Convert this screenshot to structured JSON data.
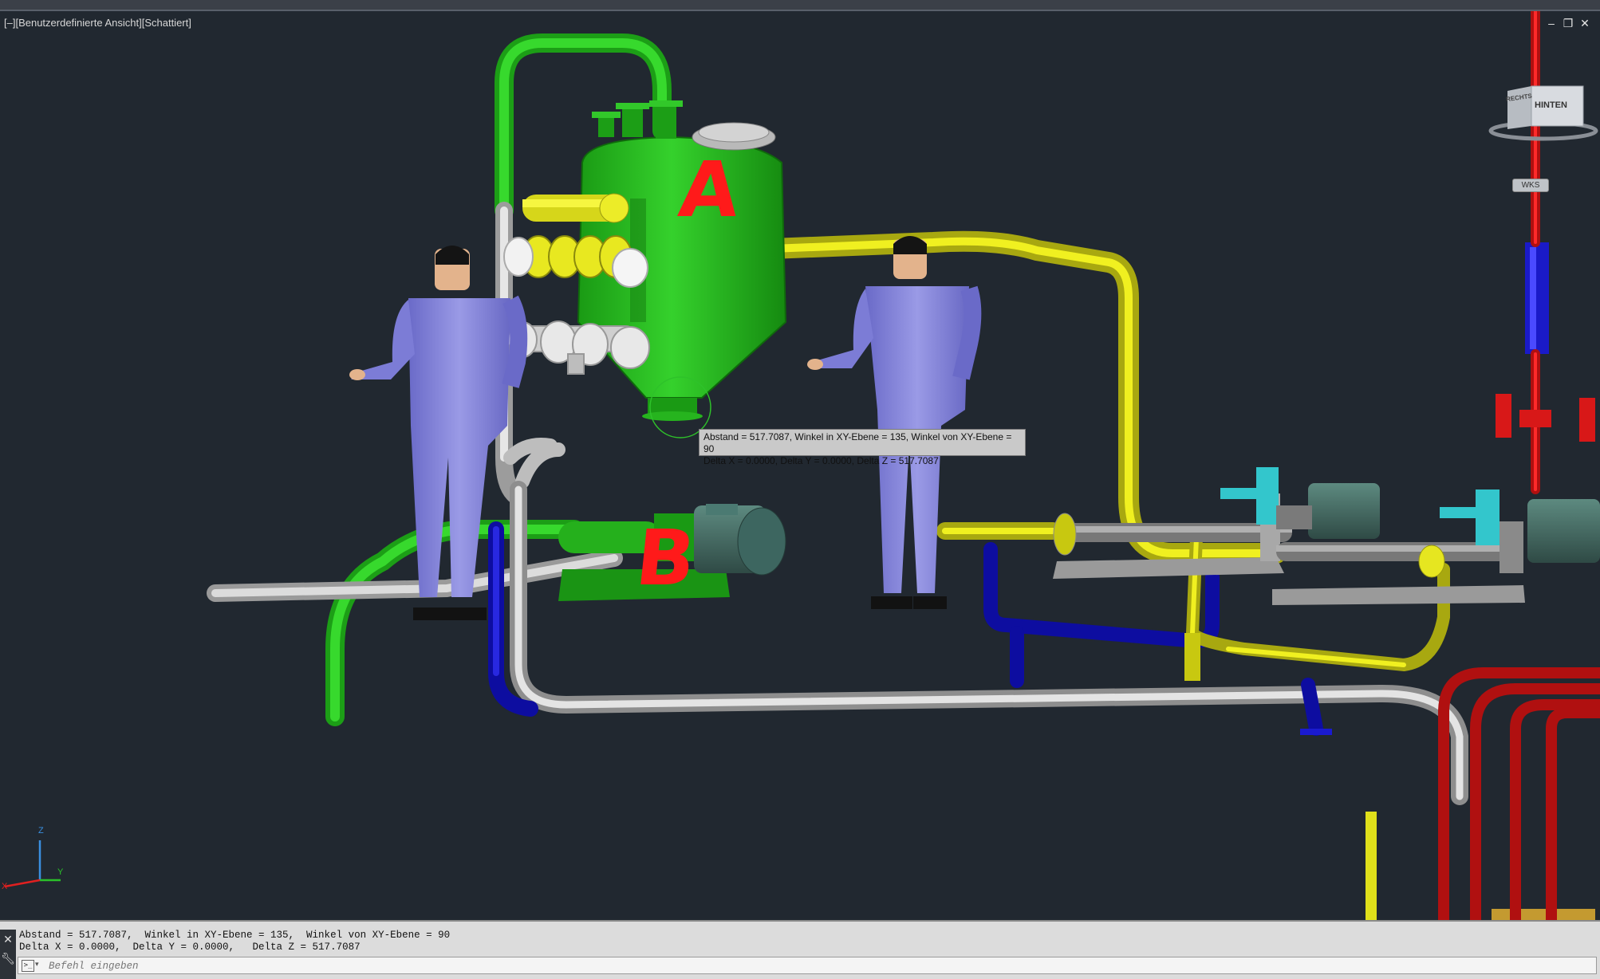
{
  "viewport": {
    "label": "[–][Benutzerdefinierte Ansicht][Schattiert]",
    "window_controls": {
      "minimize": "–",
      "restore": "❐",
      "close": "✕"
    }
  },
  "view_cube": {
    "face_label": "HINTEN",
    "side_label": "RECHTS",
    "ucs_label": "WKS"
  },
  "markers": {
    "a": "A",
    "b": "B"
  },
  "tooltip": {
    "line1": "Abstand = 517.7087,  Winkel in XY-Ebene = 135,  Winkel von XY-Ebene = 90",
    "line2": "Delta X = 0.0000,  Delta Y = 0.0000,   Delta Z = 517.7087"
  },
  "ucs_icon": {
    "z": "Z",
    "y": "Y",
    "x": "X"
  },
  "command": {
    "history_line1": "Abstand = 517.7087,  Winkel in XY-Ebene = 135,  Winkel von XY-Ebene = 90",
    "history_line2": "Delta X = 0.0000,  Delta Y = 0.0000,   Delta Z = 517.7087",
    "placeholder": "Befehl eingeben",
    "close_icon": "close-icon",
    "customize_icon": "wrench-icon"
  },
  "colors": {
    "background": "#212830",
    "green_pipe": "#22c01a",
    "yellow_pipe": "#dede1a",
    "white_pipe": "#d4d4d4",
    "blue_pipe": "#1a1ad0",
    "red_pipe": "#e01818",
    "cyan_part": "#33c6cc",
    "worker": "#7f7fd8",
    "marker_text": "#ff1a1a"
  }
}
